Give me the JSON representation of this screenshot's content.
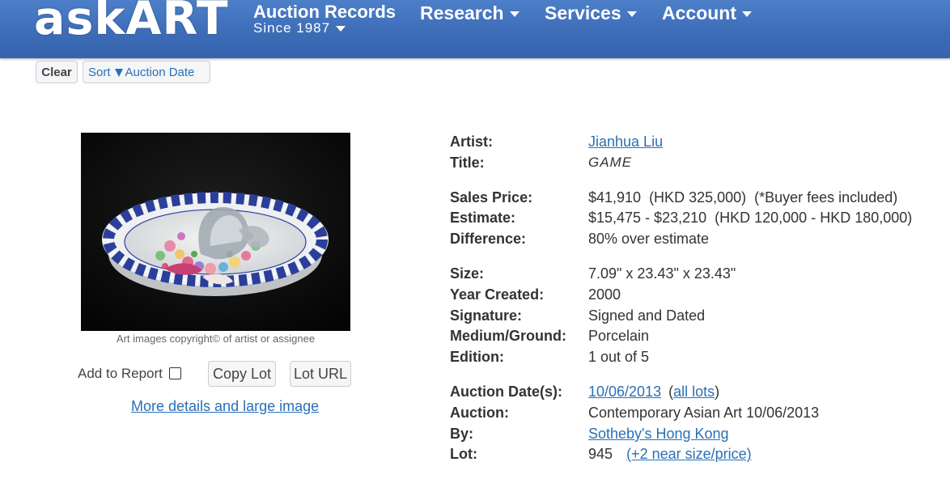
{
  "header": {
    "logo": "askART",
    "nav": {
      "auction_records": "Auction Records",
      "since": "Since 1987",
      "research": "Research",
      "services": "Services",
      "account": "Account"
    }
  },
  "toolbar": {
    "clear_label": "Clear",
    "sort_label": "Sort",
    "sort_field": "Auction Date"
  },
  "image": {
    "caption": "Art images copyright© of artist or assignee",
    "add_report_label": "Add to Report",
    "add_report_checked": false,
    "copy_lot_label": "Copy Lot",
    "lot_url_label": "Lot URL",
    "more_details_link": "More details and large image"
  },
  "details": {
    "artist_label": "Artist:",
    "artist": "Jianhua Liu",
    "title_label": "Title:",
    "title": "GAME",
    "sales_price_label": "Sales Price:",
    "sales_price": "$41,910  (HKD 325,000)  (*Buyer fees included)",
    "estimate_label": "Estimate:",
    "estimate": "$15,475 - $23,210  (HKD 120,000 - HKD 180,000)",
    "difference_label": "Difference:",
    "difference": "80% over estimate",
    "size_label": "Size:",
    "size": "7.09\" x 23.43\" x 23.43\"",
    "year_label": "Year Created:",
    "year": "2000",
    "signature_label": "Signature:",
    "signature": "Signed and Dated",
    "medium_label": "Medium/Ground:",
    "medium": "Porcelain",
    "edition_label": "Edition:",
    "edition": "1 out of 5",
    "auction_dates_label": "Auction Date(s):",
    "auction_date": "10/06/2013",
    "all_lots_open": "(",
    "all_lots": "all lots",
    "all_lots_close": ")",
    "auction_label": "Auction:",
    "auction": "Contemporary Asian Art 10/06/2013",
    "by_label": "By:",
    "by": "Sotheby's Hong Kong",
    "lot_label": "Lot:",
    "lot": "945",
    "near_size_price": "(+2 near size/price)"
  },
  "colors": {
    "header_blue": "#3e6db8",
    "link_blue": "#2a6fb5"
  }
}
